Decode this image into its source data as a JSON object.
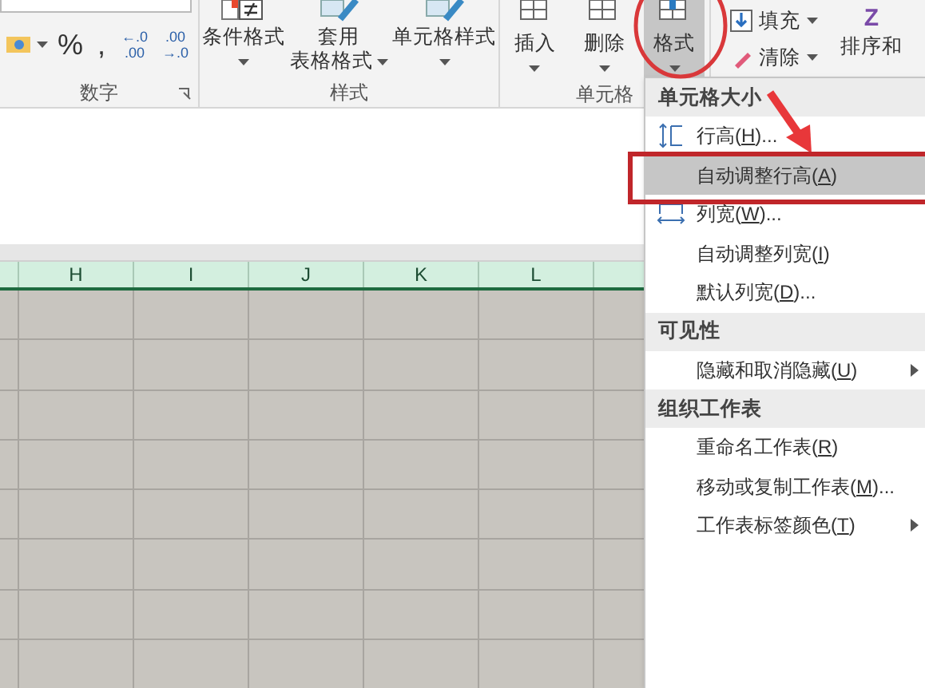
{
  "number_group": {
    "label": "数字",
    "buttons": [
      {
        "kind": "currency"
      },
      {
        "kind": "symbol",
        "text": "%"
      },
      {
        "kind": "symbol",
        "text": ","
      },
      {
        "kind": "decimal",
        "top": "←.0",
        "bottom": ".00"
      },
      {
        "kind": "decimal",
        "top": ".00",
        "bottom": "→.0"
      }
    ]
  },
  "styles_group": {
    "label": "样式",
    "buttons": [
      {
        "lines": [
          "条件格式"
        ]
      },
      {
        "lines": [
          "套用",
          "表格格式"
        ]
      },
      {
        "lines": [
          "单元格样式"
        ]
      }
    ]
  },
  "cells_group": {
    "label": "单元格",
    "buttons": [
      {
        "label": "插入",
        "pressed": false
      },
      {
        "label": "删除",
        "pressed": false
      },
      {
        "label": "格式",
        "pressed": true
      }
    ]
  },
  "editing_group": {
    "buttons": [
      {
        "label": "填充"
      },
      {
        "label": "清除"
      },
      {
        "label": "排序和",
        "icon_text": "Z"
      }
    ]
  },
  "columns": [
    "H",
    "I",
    "J",
    "K",
    "L"
  ],
  "menu": {
    "sections": [
      {
        "title": "单元格大小",
        "items": [
          {
            "label": "行高(",
            "key": "H",
            "after": ")...",
            "selected": false,
            "submenu": false
          },
          {
            "label": "自动调整行高(",
            "key": "A",
            "after": ")",
            "selected": true,
            "submenu": false
          },
          {
            "label": "列宽(",
            "key": "W",
            "after": ")...",
            "selected": false,
            "submenu": false
          },
          {
            "label": "自动调整列宽(",
            "key": "I",
            "after": ")",
            "selected": false,
            "submenu": false
          },
          {
            "label": "默认列宽(",
            "key": "D",
            "after": ")...",
            "selected": false,
            "submenu": false
          }
        ]
      },
      {
        "title": "可见性",
        "items": [
          {
            "label": "隐藏和取消隐藏(",
            "key": "U",
            "after": ")",
            "selected": false,
            "submenu": true
          }
        ]
      },
      {
        "title": "组织工作表",
        "items": [
          {
            "label": "重命名工作表(",
            "key": "R",
            "after": ")",
            "selected": false,
            "submenu": false
          },
          {
            "label": "移动或复制工作表(",
            "key": "M",
            "after": ")...",
            "selected": false,
            "submenu": false
          },
          {
            "label": "工作表标签颜色(",
            "key": "T",
            "after": ")",
            "selected": false,
            "submenu": true
          }
        ]
      }
    ]
  }
}
